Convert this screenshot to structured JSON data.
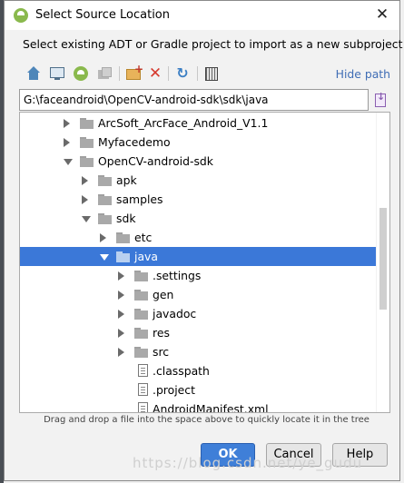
{
  "window": {
    "title": "Select Source Location"
  },
  "description": "Select existing ADT or Gradle project to import as a new subproject",
  "toolbar": {
    "icons": [
      "home-icon",
      "desktop-icon",
      "android-icon",
      "module-icon",
      "new-folder-icon",
      "delete-icon",
      "refresh-icon",
      "show-hidden-icon"
    ],
    "hide_path_label": "Hide path"
  },
  "path": {
    "value": "G:\\faceandroid\\OpenCV-android-sdk\\sdk\\java"
  },
  "tree": {
    "rows": [
      {
        "label": "ArcSoft_ArcFace_Android_V1.1",
        "type": "folder",
        "expand": "collapsed",
        "depth": 1
      },
      {
        "label": "Myfacedemo",
        "type": "folder",
        "expand": "collapsed",
        "depth": 1
      },
      {
        "label": "OpenCV-android-sdk",
        "type": "folder",
        "expand": "expanded",
        "depth": 1
      },
      {
        "label": "apk",
        "type": "folder",
        "expand": "collapsed",
        "depth": 2
      },
      {
        "label": "samples",
        "type": "folder",
        "expand": "collapsed",
        "depth": 2
      },
      {
        "label": "sdk",
        "type": "folder",
        "expand": "expanded",
        "depth": 2
      },
      {
        "label": "etc",
        "type": "folder",
        "expand": "collapsed",
        "depth": 3
      },
      {
        "label": "java",
        "type": "folder",
        "expand": "expanded",
        "depth": 3,
        "selected": true
      },
      {
        "label": ".settings",
        "type": "folder",
        "expand": "collapsed",
        "depth": 4
      },
      {
        "label": "gen",
        "type": "folder",
        "expand": "collapsed",
        "depth": 4
      },
      {
        "label": "javadoc",
        "type": "folder",
        "expand": "collapsed",
        "depth": 4
      },
      {
        "label": "res",
        "type": "folder",
        "expand": "collapsed",
        "depth": 4
      },
      {
        "label": "src",
        "type": "folder",
        "expand": "collapsed",
        "depth": 4
      },
      {
        "label": ".classpath",
        "type": "file",
        "expand": "none",
        "depth": 4
      },
      {
        "label": ".project",
        "type": "file",
        "expand": "none",
        "depth": 4
      },
      {
        "label": "AndroidManifest.xml",
        "type": "file",
        "expand": "none",
        "depth": 4
      }
    ]
  },
  "hint": "Drag and drop a file into the space above to quickly locate it in the tree",
  "buttons": {
    "ok": "OK",
    "cancel": "Cancel",
    "help": "Help"
  },
  "watermark": "https://blog.csdn.net/ye_gudu"
}
